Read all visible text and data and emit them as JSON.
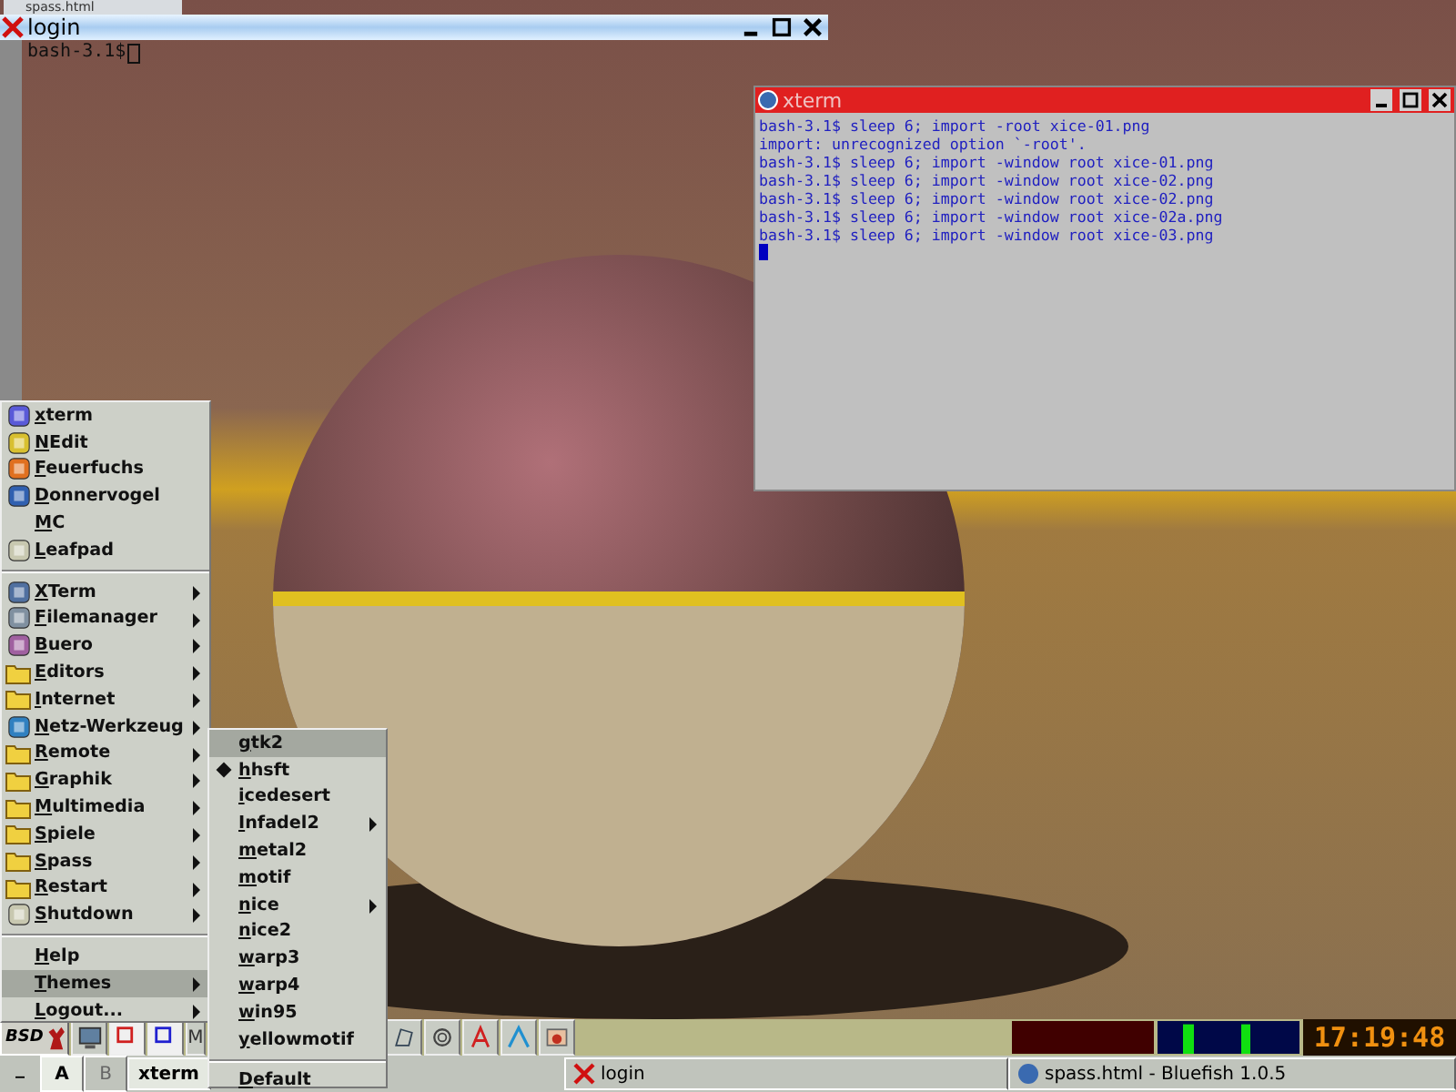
{
  "background_window": {
    "title": "spass.html"
  },
  "login_window": {
    "title": "login",
    "prompt": "bash-3.1$"
  },
  "xterm_window": {
    "title": "xterm",
    "lines": [
      "bash-3.1$ sleep 6; import -root xice-01.png",
      "import: unrecognized option `-root'.",
      "bash-3.1$ sleep 6; import -window root xice-01.png",
      "bash-3.1$ sleep 6; import -window root xice-02.png",
      "bash-3.1$ sleep 6; import -window root xice-02.png",
      "bash-3.1$ sleep 6; import -window root xice-02a.png",
      "bash-3.1$ sleep 6; import -window root xice-03.png"
    ]
  },
  "start_menu": {
    "groups": [
      [
        {
          "label": "xterm",
          "kind": "app",
          "submenu": false,
          "selected": false
        },
        {
          "label": "NEdit",
          "kind": "app",
          "submenu": false,
          "selected": false
        },
        {
          "label": "Feuerfuchs",
          "kind": "app",
          "submenu": false,
          "selected": false
        },
        {
          "label": "Donnervogel",
          "kind": "app",
          "submenu": false,
          "selected": false
        },
        {
          "label": "MC",
          "kind": "plain",
          "submenu": false,
          "selected": false
        },
        {
          "label": "Leafpad",
          "kind": "app",
          "submenu": false,
          "selected": false
        }
      ],
      [
        {
          "label": "XTerm",
          "kind": "app",
          "submenu": true,
          "selected": false
        },
        {
          "label": "Filemanager",
          "kind": "app",
          "submenu": true,
          "selected": false
        },
        {
          "label": "Buero",
          "kind": "app",
          "submenu": true,
          "selected": false
        },
        {
          "label": "Editors",
          "kind": "folder",
          "submenu": true,
          "selected": false
        },
        {
          "label": "Internet",
          "kind": "folder",
          "submenu": true,
          "selected": false
        },
        {
          "label": "Netz-Werkzeug",
          "kind": "app",
          "submenu": true,
          "selected": false
        },
        {
          "label": "Remote",
          "kind": "folder",
          "submenu": true,
          "selected": false
        },
        {
          "label": "Graphik",
          "kind": "folder",
          "submenu": true,
          "selected": false
        },
        {
          "label": "Multimedia",
          "kind": "folder",
          "submenu": true,
          "selected": false
        },
        {
          "label": "Spiele",
          "kind": "folder",
          "submenu": true,
          "selected": false
        },
        {
          "label": "Spass",
          "kind": "folder",
          "submenu": true,
          "selected": false
        },
        {
          "label": "Restart",
          "kind": "folder",
          "submenu": true,
          "selected": false
        },
        {
          "label": "Shutdown",
          "kind": "app",
          "submenu": true,
          "selected": false
        }
      ],
      [
        {
          "label": "Help",
          "kind": "plain",
          "submenu": false,
          "selected": false
        },
        {
          "label": "Themes",
          "kind": "plain",
          "submenu": true,
          "selected": true
        },
        {
          "label": "Logout...",
          "kind": "plain",
          "submenu": true,
          "selected": false
        }
      ]
    ]
  },
  "themes_menu": {
    "items": [
      {
        "label": "gtk2",
        "selected": true,
        "checked": false,
        "submenu": false
      },
      {
        "label": "hhsft",
        "selected": false,
        "checked": true,
        "submenu": false
      },
      {
        "label": "icedesert",
        "selected": false,
        "checked": false,
        "submenu": false
      },
      {
        "label": "Infadel2",
        "selected": false,
        "checked": false,
        "submenu": true
      },
      {
        "label": "metal2",
        "selected": false,
        "checked": false,
        "submenu": false
      },
      {
        "label": "motif",
        "selected": false,
        "checked": false,
        "submenu": false
      },
      {
        "label": "nice",
        "selected": false,
        "checked": false,
        "submenu": true
      },
      {
        "label": "nice2",
        "selected": false,
        "checked": false,
        "submenu": false
      },
      {
        "label": "warp3",
        "selected": false,
        "checked": false,
        "submenu": false
      },
      {
        "label": "warp4",
        "selected": false,
        "checked": false,
        "submenu": false
      },
      {
        "label": "win95",
        "selected": false,
        "checked": false,
        "submenu": false
      },
      {
        "label": "yellowmotif",
        "selected": false,
        "checked": false,
        "submenu": false
      }
    ],
    "footer": "Default"
  },
  "taskbar": {
    "start_label": "BSD",
    "launcher_letter": "M",
    "clock": "17:19:48",
    "minimize_label": "_",
    "desks": [
      {
        "label": "A",
        "selected": true
      },
      {
        "label": "B",
        "selected": false
      }
    ],
    "tasks": [
      {
        "label": "xterm",
        "kind": "plain"
      },
      {
        "label": "login",
        "kind": "x"
      },
      {
        "label": "spass.html - Bluefish 1.0.5",
        "kind": "globe"
      }
    ]
  }
}
